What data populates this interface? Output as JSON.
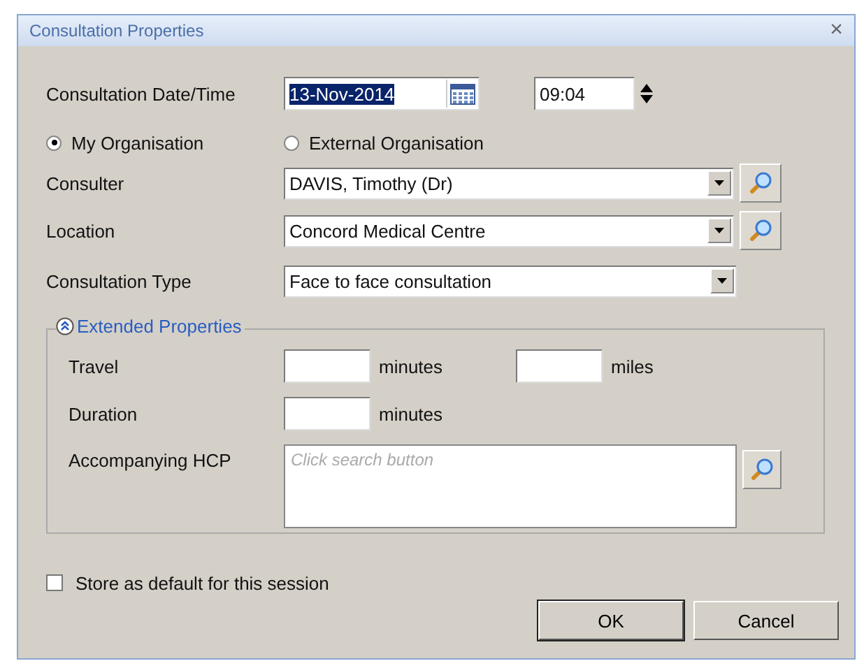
{
  "window": {
    "title": "Consultation Properties",
    "close": "×"
  },
  "date_time": {
    "label": "Consultation Date/Time",
    "date": "13-Nov-2014",
    "date_selected": true,
    "time": "09:04"
  },
  "organisation": [
    {
      "label": "My Organisation",
      "selected": true
    },
    {
      "label": "External Organisation",
      "selected": false
    }
  ],
  "fields": [
    {
      "kind": "search",
      "label": "Consulter",
      "value": "DAVIS, Timothy (Dr)"
    },
    {
      "kind": "search",
      "label": "Location",
      "value": "Concord Medical Centre"
    },
    {
      "kind": "plain",
      "label": "Consultation Type",
      "value": "Face to face consultation"
    }
  ],
  "extended_properties": {
    "title": "Extended Properties",
    "expanded": true,
    "travel": {
      "label": "Travel",
      "unit_1": "minutes",
      "unit_2": "miles"
    },
    "duration": {
      "label": "Duration",
      "unit": "minutes"
    },
    "accompanying_hcp": {
      "label": "Accompanying HCP",
      "placeholder": "Click search button"
    }
  },
  "store_default": {
    "label": "Store as default for this session",
    "checked": false
  },
  "buttons": [
    "OK",
    "Cancel"
  ]
}
